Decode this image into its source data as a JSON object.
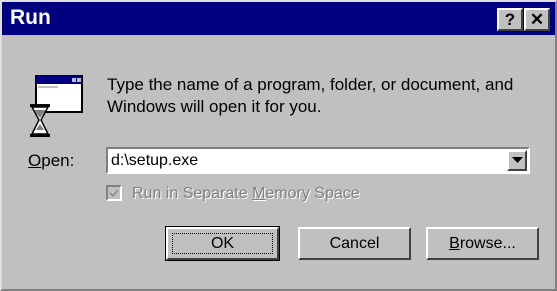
{
  "window": {
    "title": "Run",
    "help_button": "?",
    "close_button": "✕"
  },
  "description": "Type the name of a program, folder, or document, and Windows will open it for you.",
  "open": {
    "label_underlined": "O",
    "label_rest": "pen:",
    "value": "d:\\setup.exe"
  },
  "separate_memory": {
    "label_before": "Run in Separate ",
    "label_underlined": "M",
    "label_after": "emory Space",
    "checked": true,
    "enabled": false
  },
  "buttons": {
    "ok": "OK",
    "cancel": "Cancel",
    "browse_underlined": "B",
    "browse_rest": "rowse..."
  },
  "icons": {
    "run": "run-program-icon",
    "dropdown": "chevron-down-icon",
    "checkmark": "checkmark-icon"
  },
  "colors": {
    "titlebar": "#000080",
    "face": "#c0c0c0",
    "disabled_text": "#808080"
  }
}
